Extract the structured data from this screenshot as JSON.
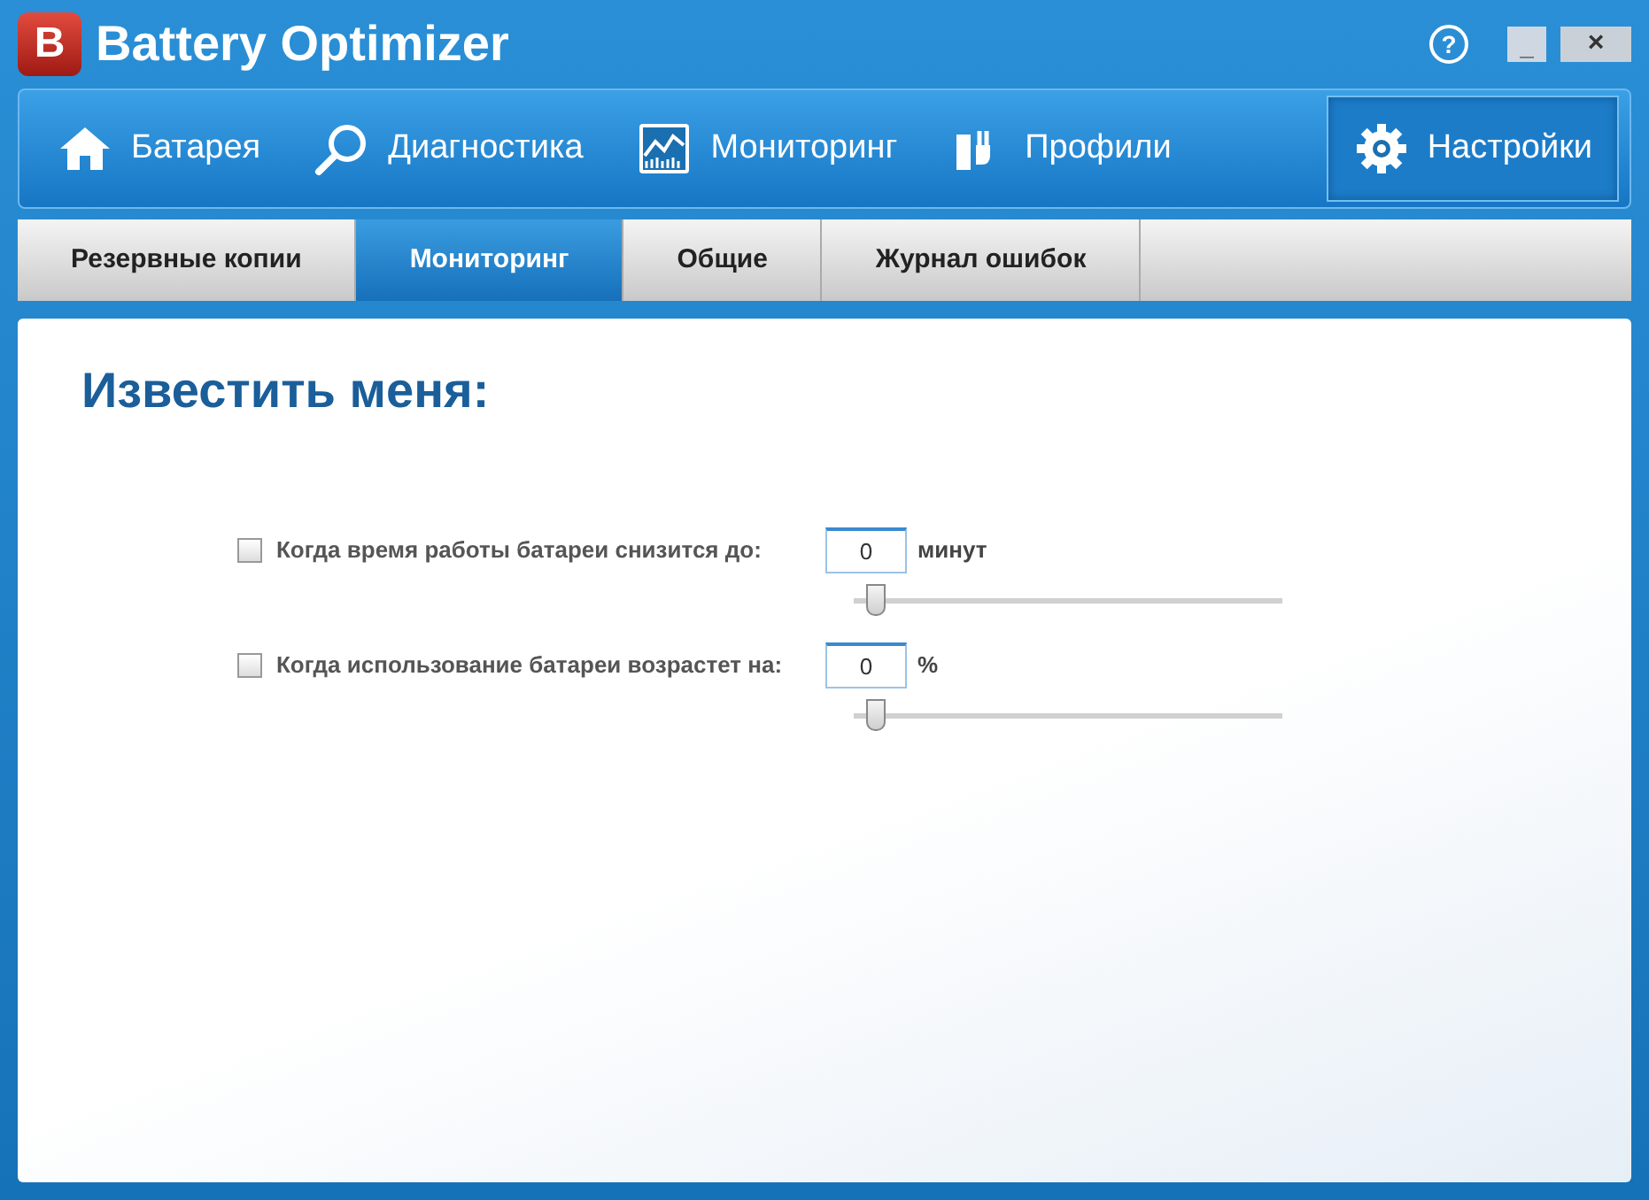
{
  "window": {
    "logo": "B",
    "title": "Battery Optimizer",
    "help": "?",
    "minimize": "_",
    "close": "×"
  },
  "nav": [
    {
      "kind": "home",
      "label": "Батарея",
      "selected": false
    },
    {
      "kind": "search",
      "label": "Диагностика",
      "selected": false
    },
    {
      "kind": "chart",
      "label": "Мониторинг",
      "selected": false
    },
    {
      "kind": "plug",
      "label": "Профили",
      "selected": false
    },
    {
      "kind": "gear",
      "label": "Настройки",
      "selected": true
    }
  ],
  "subtabs": [
    {
      "label": "Резервные копии",
      "selected": false
    },
    {
      "label": "Мониторинг",
      "selected": true
    },
    {
      "label": "Общие",
      "selected": false
    },
    {
      "label": "Журнал ошибок",
      "selected": false
    }
  ],
  "heading": "Известить меня:",
  "settings": [
    {
      "label": "Когда время работы батареи снизится до:",
      "checked": false,
      "value": "0",
      "unit": "минут",
      "level": 0.05
    },
    {
      "label": "Когда использование батареи возрастет на:",
      "checked": false,
      "value": "0",
      "unit": "%",
      "level": 0.05
    }
  ]
}
